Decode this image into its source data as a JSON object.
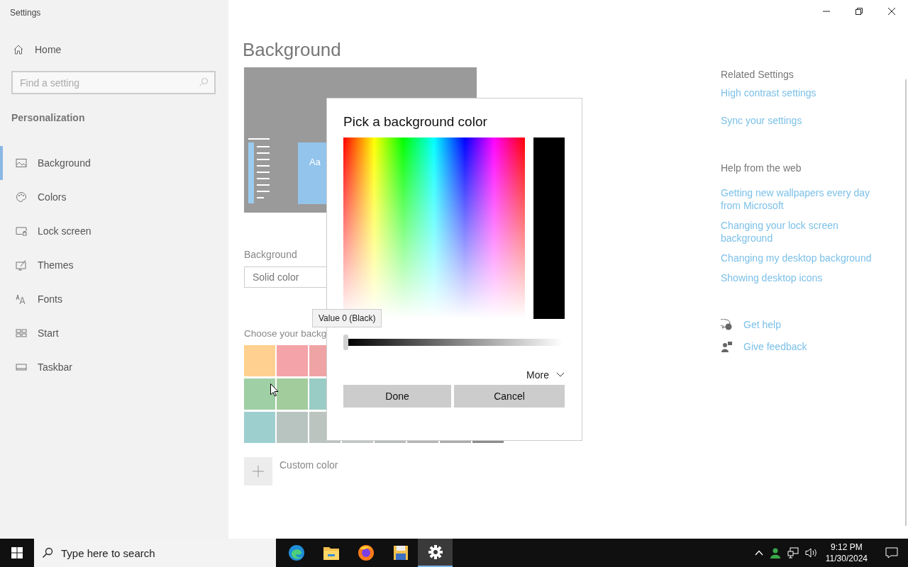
{
  "window": {
    "title": "Settings"
  },
  "sidebar": {
    "home": "Home",
    "search": {
      "placeholder": "Find a setting"
    },
    "section": "Personalization",
    "items": [
      {
        "label": "Background",
        "selected": true
      },
      {
        "label": "Colors",
        "selected": false
      },
      {
        "label": "Lock screen",
        "selected": false
      },
      {
        "label": "Themes",
        "selected": false
      },
      {
        "label": "Fonts",
        "selected": false
      },
      {
        "label": "Start",
        "selected": false
      },
      {
        "label": "Taskbar",
        "selected": false
      }
    ]
  },
  "main": {
    "heading": "Background",
    "preview_tile_text": "Aa",
    "background_label": "Background",
    "background_dropdown": "Solid color",
    "choose_label": "Choose your backg",
    "swatch_rows": [
      [
        {
          "color": "#ffd08f"
        },
        {
          "color": "#f4a3a8"
        },
        {
          "color": "#f0a3a5"
        }
      ],
      [
        {
          "color": "#9fcfa4"
        },
        {
          "color": "#a2cc9c"
        },
        {
          "color": "#99ccc4"
        }
      ],
      [
        {
          "color": "#9dcfcf"
        },
        {
          "color": "#b8c4c0"
        },
        {
          "color": "#bcc4c0"
        },
        {
          "color": "#c2c6c4"
        },
        {
          "color": "#b8bcba"
        },
        {
          "color": "#b4b6b6"
        },
        {
          "color": "#acacac"
        },
        {
          "color": "#8c8c8c"
        }
      ]
    ],
    "custom_color": "Custom color"
  },
  "related": {
    "title": "Related Settings",
    "links": [
      "High contrast settings",
      "Sync your settings"
    ]
  },
  "help": {
    "title": "Help from the web",
    "links": [
      "Getting new wallpapers every day from Microsoft",
      "Changing your lock screen background",
      "Changing my desktop background",
      "Showing desktop icons"
    ]
  },
  "support": [
    {
      "kind": "help",
      "label": "Get help"
    },
    {
      "kind": "feedback",
      "label": "Give feedback"
    }
  ],
  "dialog": {
    "title": "Pick a background color",
    "value_slider": {
      "level": 0
    },
    "tooltip": "Value 0 (Black)",
    "more": "More",
    "buttons": [
      "Done",
      "Cancel"
    ]
  },
  "taskbar": {
    "search": {
      "placeholder": "Type here to search"
    },
    "apps": [
      {
        "kind": "browser",
        "selected": false
      },
      {
        "kind": "folder",
        "selected": false
      },
      {
        "kind": "firefox",
        "selected": false
      },
      {
        "kind": "disk",
        "selected": false
      },
      {
        "kind": "settings",
        "selected": true
      }
    ],
    "time": "9:12 PM",
    "date": "11/30/2024"
  }
}
